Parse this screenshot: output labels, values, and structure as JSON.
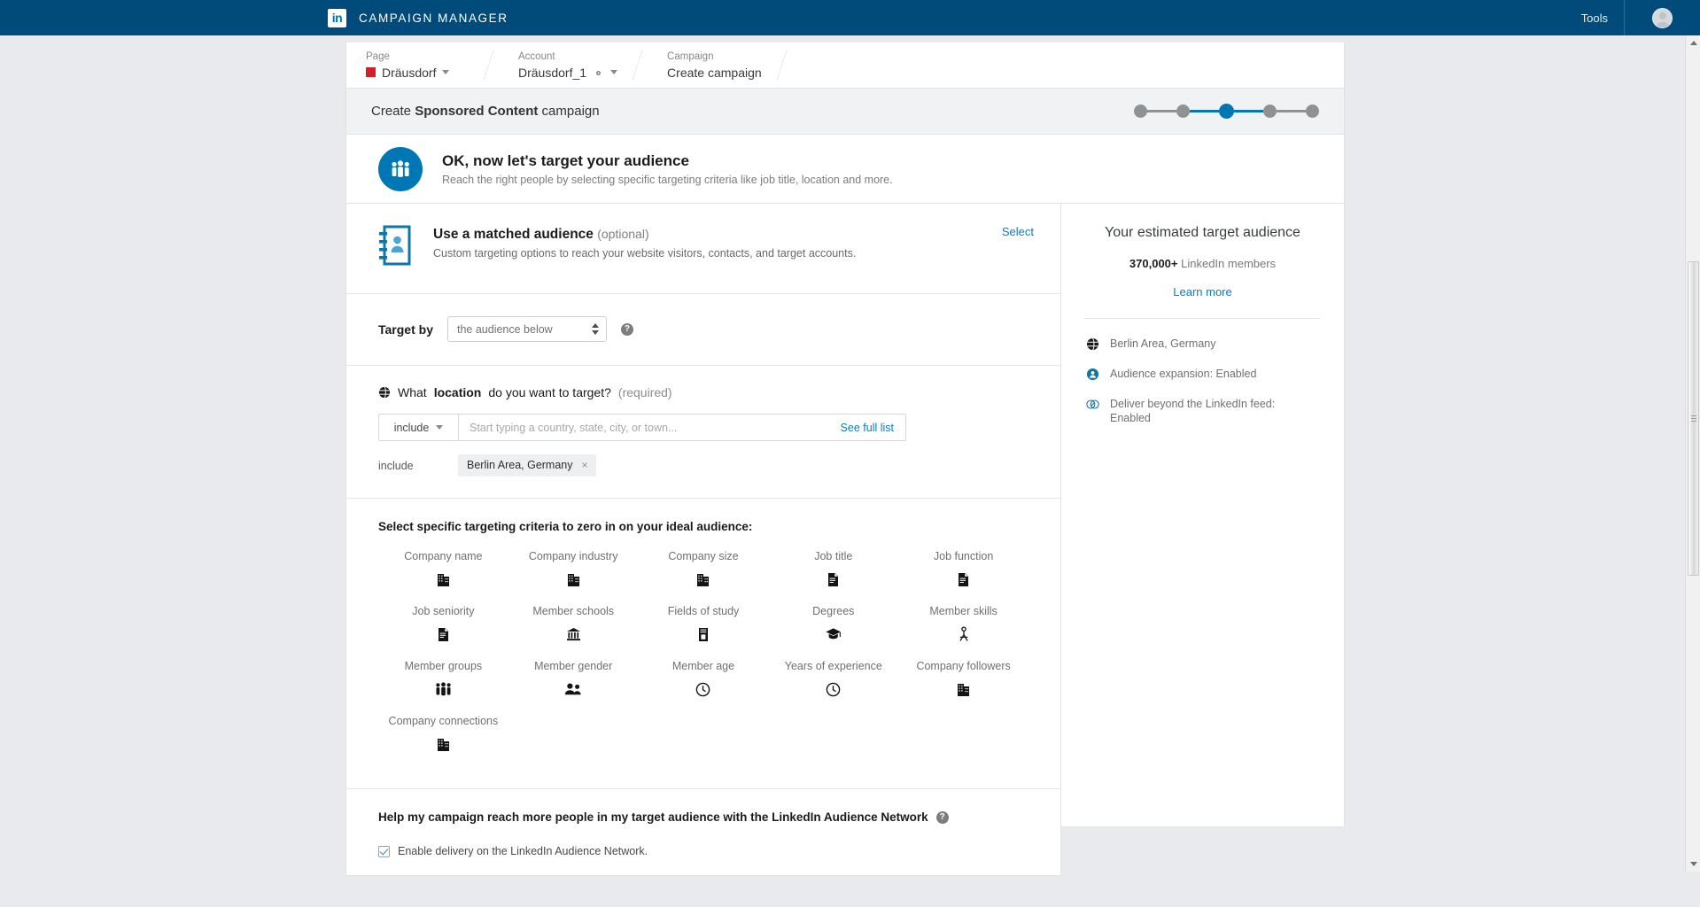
{
  "topbar": {
    "logo_text": "in",
    "brand_title": "CAMPAIGN MANAGER",
    "tools_label": "Tools",
    "avatar_name": "user-avatar"
  },
  "breadcrumb": [
    {
      "label": "Page",
      "value": "Dräusdorf",
      "has_swatch": true,
      "has_caret": true,
      "has_gear": false
    },
    {
      "label": "Account",
      "value": "Dräusdorf_1",
      "has_swatch": false,
      "has_caret": true,
      "has_gear": true
    },
    {
      "label": "Campaign",
      "value": "Create campaign",
      "has_swatch": false,
      "has_caret": false,
      "has_gear": false
    }
  ],
  "campaign_header": {
    "title_pre": "Create ",
    "title_bold": "Sponsored Content",
    "title_post": " campaign",
    "steps_total": 5,
    "active_step": 3,
    "active_color": "#0077b5",
    "inactive_color": "#8e9295"
  },
  "hero": {
    "icon": "audience-people-icon",
    "heading": "OK, now let's target your audience",
    "subheading": "Reach the right people by selecting specific targeting criteria like job title, location and more."
  },
  "matched_audience": {
    "icon": "contact-card-icon",
    "heading_bold": "Use a matched audience",
    "heading_optional": "(optional)",
    "description": "Custom targeting options to reach your website visitors, contacts, and target accounts.",
    "select_label": "Select"
  },
  "target_by": {
    "label": "Target by",
    "selected_value": "the audience below",
    "help_icon": "question-mark-icon"
  },
  "location": {
    "icon": "globe-icon",
    "question_pre": "What ",
    "question_bold": "location",
    "question_post": " do you want to target? ",
    "required_note": "(required)",
    "include_label": "include",
    "input_placeholder": "Start typing a country, state, city, or town...",
    "see_full_list": "See full list",
    "chip_row_label": "include",
    "chips": [
      {
        "text": "Berlin Area, Germany",
        "remove": "×"
      }
    ]
  },
  "criteria": {
    "heading": "Select specific targeting criteria to zero in on your ideal audience:",
    "items": [
      {
        "label": "Company name",
        "icon": "company-building-icon"
      },
      {
        "label": "Company industry",
        "icon": "company-building-icon"
      },
      {
        "label": "Company size",
        "icon": "company-building-icon"
      },
      {
        "label": "Job title",
        "icon": "document-icon"
      },
      {
        "label": "Job function",
        "icon": "document-icon"
      },
      {
        "label": "Job seniority",
        "icon": "document-icon"
      },
      {
        "label": "Member schools",
        "icon": "bank-columns-icon"
      },
      {
        "label": "Fields of study",
        "icon": "book-icon"
      },
      {
        "label": "Degrees",
        "icon": "graduation-cap-icon"
      },
      {
        "label": "Member skills",
        "icon": "person-compass-icon"
      },
      {
        "label": "Member groups",
        "icon": "people-group-icon"
      },
      {
        "label": "Member gender",
        "icon": "two-people-icon"
      },
      {
        "label": "Member age",
        "icon": "clock-icon"
      },
      {
        "label": "Years of experience",
        "icon": "clock-icon"
      },
      {
        "label": "Company followers",
        "icon": "company-building-icon"
      },
      {
        "label": "Company connections",
        "icon": "company-building-icon"
      }
    ]
  },
  "audience_network": {
    "heading": "Help my campaign reach more people in my target audience with the LinkedIn Audience Network",
    "help_icon": "question-mark-icon",
    "checkbox_checked": true,
    "checkbox_label": "Enable delivery on the LinkedIn Audience Network."
  },
  "estimate_panel": {
    "heading": "Your estimated target audience",
    "count": "370,000+",
    "count_suffix": "LinkedIn members",
    "learn_more": "Learn more",
    "items": [
      {
        "icon": "globe-icon",
        "text": "Berlin Area, Germany"
      },
      {
        "icon": "audience-expansion-icon",
        "text": "Audience expansion: Enabled"
      },
      {
        "icon": "beyond-feed-icon",
        "text": "Deliver beyond the LinkedIn feed: Enabled"
      }
    ]
  },
  "colors": {
    "brand_blue": "#004b79",
    "link_blue": "#0b7cc1",
    "accent_blue": "#0077b5",
    "page_bg": "#e9eaee",
    "swatch_red": "#cf2127"
  }
}
